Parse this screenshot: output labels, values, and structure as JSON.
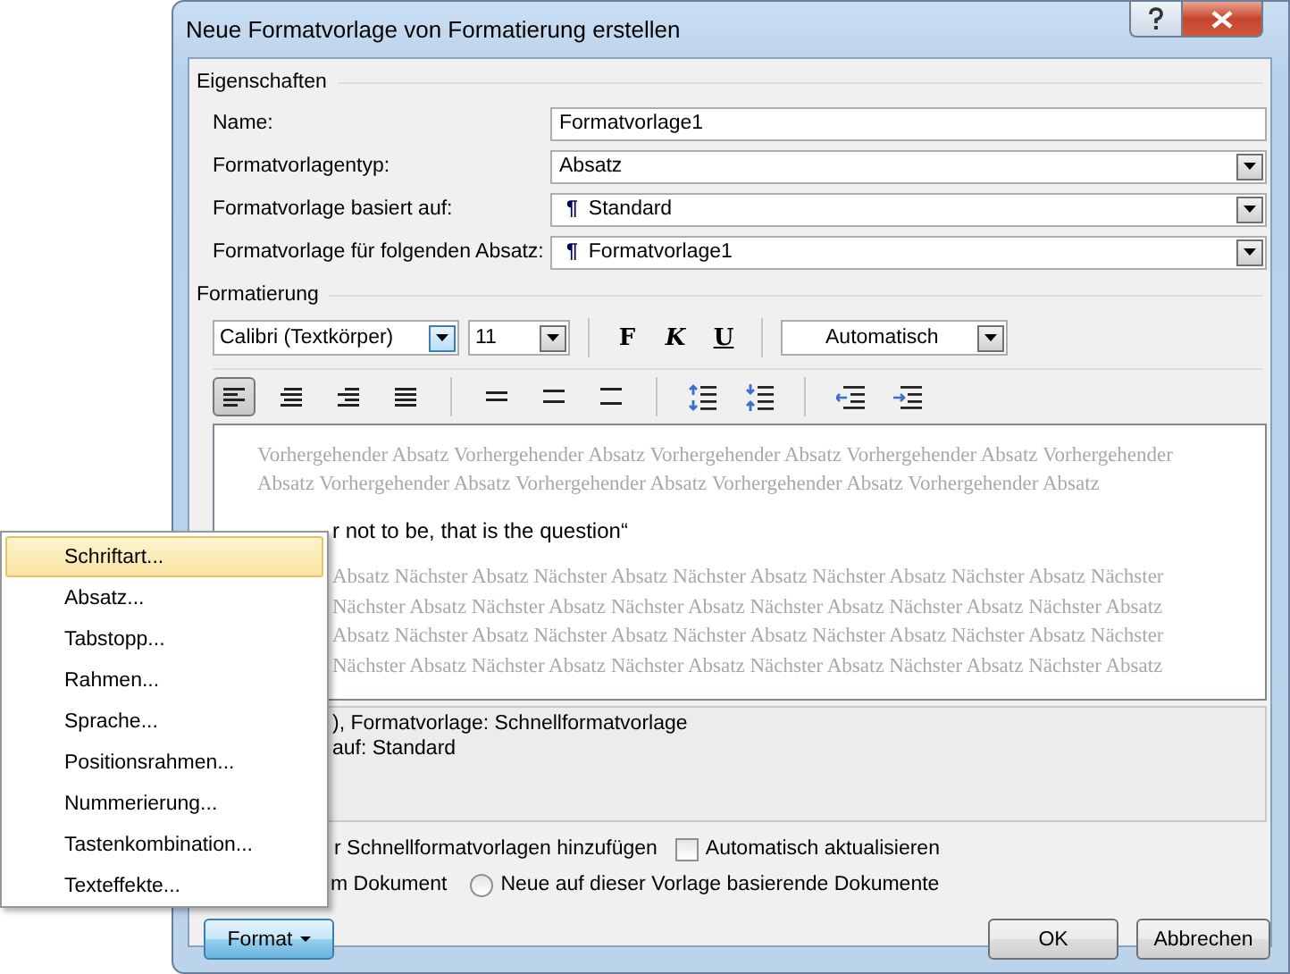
{
  "window": {
    "title": "Neue Formatvorlage von Formatierung erstellen"
  },
  "properties": {
    "heading": "Eigenschaften",
    "fields": [
      {
        "label": "Name:",
        "kind": "text",
        "value": "Formatvorlage1"
      },
      {
        "label": "Formatvorlagentyp:",
        "kind": "dropdown",
        "value": "Absatz"
      },
      {
        "label": "Formatvorlage basiert auf:",
        "kind": "dropdown",
        "marker": "¶",
        "value": "Standard"
      },
      {
        "label": "Formatvorlage für folgenden Absatz:",
        "kind": "dropdown",
        "marker": "¶",
        "value": "Formatvorlage1"
      }
    ]
  },
  "formatting": {
    "heading": "Formatierung",
    "font": "Calibri (Textkörper)",
    "size": "11",
    "bold": "F",
    "italic": "K",
    "underline": "U",
    "font_color": "Automatisch",
    "alignment": [
      {
        "selected": true
      },
      {
        "selected": false
      },
      {
        "selected": false
      },
      {
        "selected": false
      }
    ]
  },
  "preview": {
    "previous_lines": [
      "Vorhergehender Absatz Vorhergehender Absatz Vorhergehender Absatz Vorhergehender Absatz Vorhergehender",
      "Absatz Vorhergehender Absatz Vorhergehender Absatz Vorhergehender Absatz Vorhergehender Absatz"
    ],
    "sample": "r not to be, that is the question“",
    "next_lines": [
      "Absatz Nächster Absatz Nächster Absatz Nächster Absatz Nächster Absatz Nächster Absatz Nächster",
      "Nächster Absatz Nächster Absatz Nächster Absatz Nächster Absatz Nächster Absatz Nächster Absatz",
      "Absatz Nächster Absatz Nächster Absatz Nächster Absatz Nächster Absatz Nächster Absatz Nächster",
      "Nächster Absatz Nächster Absatz Nächster Absatz Nächster Absatz Nächster Absatz Nächster Absatz"
    ]
  },
  "description": [
    "), Formatvorlage: Schnellformatvorlage",
    "auf: Standard"
  ],
  "options": {
    "add_text": "r Schnellformatvorlagen hinzufügen",
    "auto_update": {
      "label": "Automatisch aktualisieren",
      "checked": false
    },
    "doc_text": "m Dokument",
    "new_docs": {
      "label": "Neue auf dieser Vorlage basierende Dokumente",
      "selected": false
    }
  },
  "buttons": {
    "format": "Format",
    "ok": "OK",
    "cancel": "Abbrechen"
  },
  "menu": [
    {
      "label": "Schriftart...",
      "selected": true
    },
    {
      "label": "Absatz...",
      "selected": false
    },
    {
      "label": "Tabstopp...",
      "selected": false
    },
    {
      "label": "Rahmen...",
      "selected": false
    },
    {
      "label": "Sprache...",
      "selected": false
    },
    {
      "label": "Positionsrahmen...",
      "selected": false
    },
    {
      "label": "Nummerierung...",
      "selected": false
    },
    {
      "label": "Tastenkombination...",
      "selected": false
    },
    {
      "label": "Texteffekte...",
      "selected": false
    }
  ]
}
